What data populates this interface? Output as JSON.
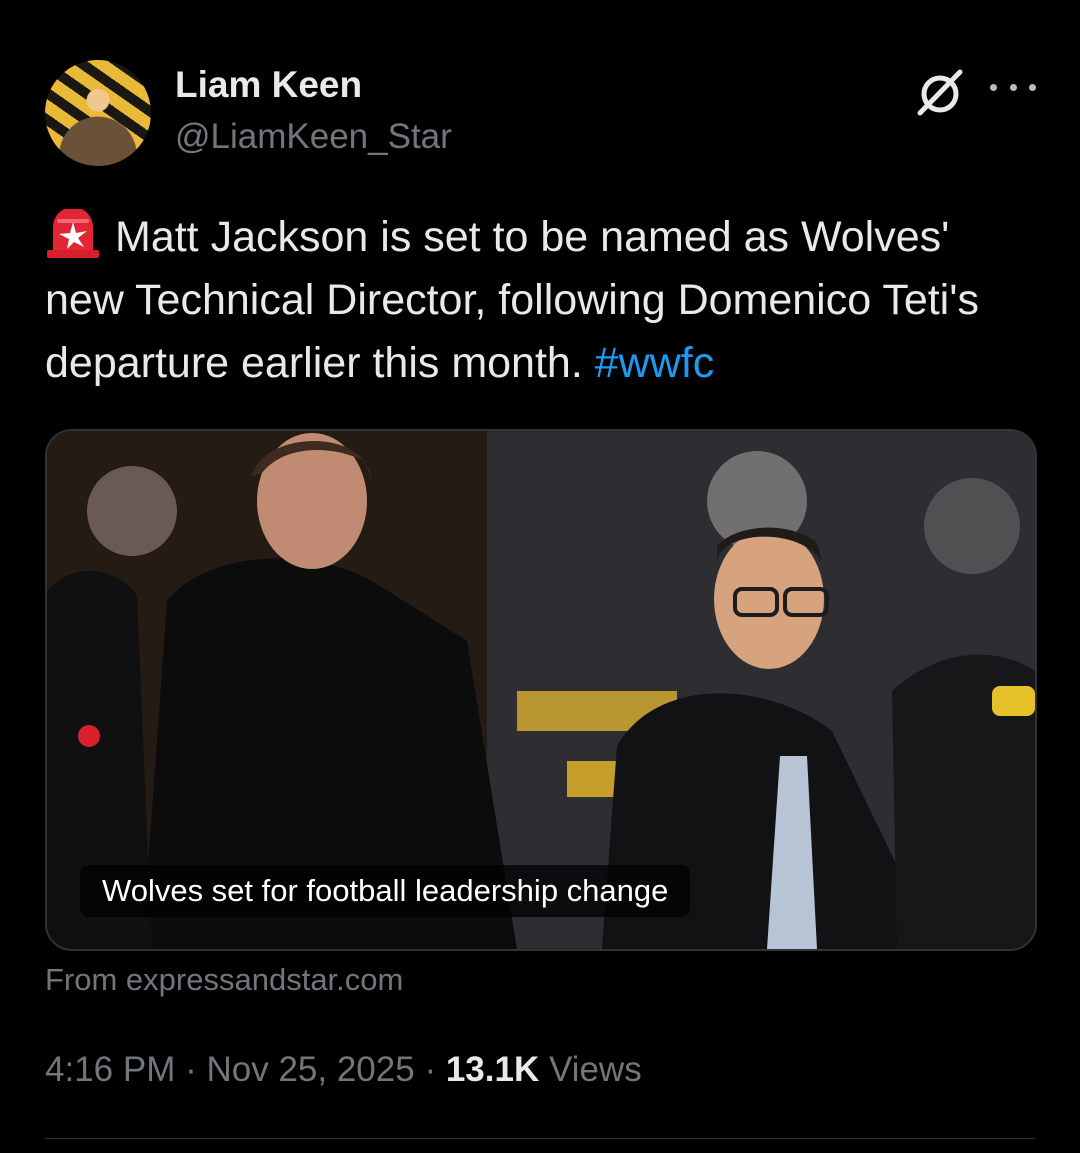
{
  "author": {
    "name": "Liam Keen",
    "handle": "@LiamKeen_Star",
    "avatar_icon": "profile-photo"
  },
  "header_actions": {
    "grok_icon": "grok-icon",
    "more_icon": "more-options-icon"
  },
  "tweet": {
    "emoji_icon": "police-siren-emoji",
    "text": "Matt Jackson is set to be named as Wolves' new Technical Director, following Domenico Teti's departure earlier this month.",
    "hashtag": "#wwfc"
  },
  "link_card": {
    "caption": "Wolves set for football leadership change",
    "source": "From expressandstar.com"
  },
  "meta": {
    "time": "4:16 PM",
    "separator": "·",
    "date": "Nov 25, 2025",
    "views_count": "13.1K",
    "views_label": "Views"
  },
  "colors": {
    "background": "#000000",
    "text": "#e7e9ea",
    "secondary_text": "#71767b",
    "link": "#1d9bf0",
    "divider": "#2f3336"
  }
}
